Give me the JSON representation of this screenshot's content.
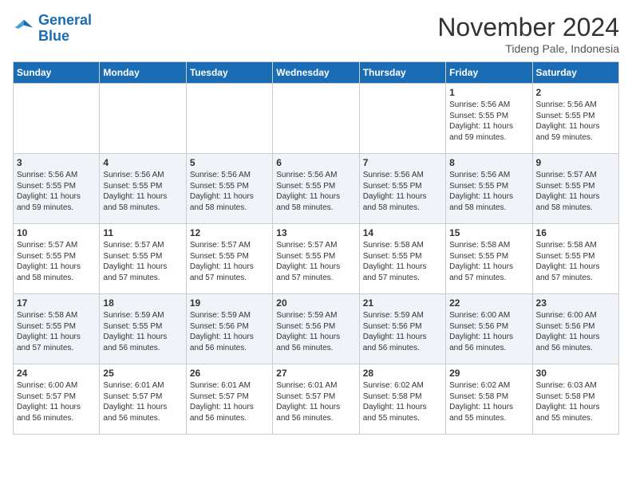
{
  "header": {
    "logo_line1": "General",
    "logo_line2": "Blue",
    "month": "November 2024",
    "location": "Tideng Pale, Indonesia"
  },
  "weekdays": [
    "Sunday",
    "Monday",
    "Tuesday",
    "Wednesday",
    "Thursday",
    "Friday",
    "Saturday"
  ],
  "weeks": [
    [
      {
        "day": "",
        "info": ""
      },
      {
        "day": "",
        "info": ""
      },
      {
        "day": "",
        "info": ""
      },
      {
        "day": "",
        "info": ""
      },
      {
        "day": "",
        "info": ""
      },
      {
        "day": "1",
        "info": "Sunrise: 5:56 AM\nSunset: 5:55 PM\nDaylight: 11 hours\nand 59 minutes."
      },
      {
        "day": "2",
        "info": "Sunrise: 5:56 AM\nSunset: 5:55 PM\nDaylight: 11 hours\nand 59 minutes."
      }
    ],
    [
      {
        "day": "3",
        "info": "Sunrise: 5:56 AM\nSunset: 5:55 PM\nDaylight: 11 hours\nand 59 minutes."
      },
      {
        "day": "4",
        "info": "Sunrise: 5:56 AM\nSunset: 5:55 PM\nDaylight: 11 hours\nand 58 minutes."
      },
      {
        "day": "5",
        "info": "Sunrise: 5:56 AM\nSunset: 5:55 PM\nDaylight: 11 hours\nand 58 minutes."
      },
      {
        "day": "6",
        "info": "Sunrise: 5:56 AM\nSunset: 5:55 PM\nDaylight: 11 hours\nand 58 minutes."
      },
      {
        "day": "7",
        "info": "Sunrise: 5:56 AM\nSunset: 5:55 PM\nDaylight: 11 hours\nand 58 minutes."
      },
      {
        "day": "8",
        "info": "Sunrise: 5:56 AM\nSunset: 5:55 PM\nDaylight: 11 hours\nand 58 minutes."
      },
      {
        "day": "9",
        "info": "Sunrise: 5:57 AM\nSunset: 5:55 PM\nDaylight: 11 hours\nand 58 minutes."
      }
    ],
    [
      {
        "day": "10",
        "info": "Sunrise: 5:57 AM\nSunset: 5:55 PM\nDaylight: 11 hours\nand 58 minutes."
      },
      {
        "day": "11",
        "info": "Sunrise: 5:57 AM\nSunset: 5:55 PM\nDaylight: 11 hours\nand 57 minutes."
      },
      {
        "day": "12",
        "info": "Sunrise: 5:57 AM\nSunset: 5:55 PM\nDaylight: 11 hours\nand 57 minutes."
      },
      {
        "day": "13",
        "info": "Sunrise: 5:57 AM\nSunset: 5:55 PM\nDaylight: 11 hours\nand 57 minutes."
      },
      {
        "day": "14",
        "info": "Sunrise: 5:58 AM\nSunset: 5:55 PM\nDaylight: 11 hours\nand 57 minutes."
      },
      {
        "day": "15",
        "info": "Sunrise: 5:58 AM\nSunset: 5:55 PM\nDaylight: 11 hours\nand 57 minutes."
      },
      {
        "day": "16",
        "info": "Sunrise: 5:58 AM\nSunset: 5:55 PM\nDaylight: 11 hours\nand 57 minutes."
      }
    ],
    [
      {
        "day": "17",
        "info": "Sunrise: 5:58 AM\nSunset: 5:55 PM\nDaylight: 11 hours\nand 57 minutes."
      },
      {
        "day": "18",
        "info": "Sunrise: 5:59 AM\nSunset: 5:55 PM\nDaylight: 11 hours\nand 56 minutes."
      },
      {
        "day": "19",
        "info": "Sunrise: 5:59 AM\nSunset: 5:56 PM\nDaylight: 11 hours\nand 56 minutes."
      },
      {
        "day": "20",
        "info": "Sunrise: 5:59 AM\nSunset: 5:56 PM\nDaylight: 11 hours\nand 56 minutes."
      },
      {
        "day": "21",
        "info": "Sunrise: 5:59 AM\nSunset: 5:56 PM\nDaylight: 11 hours\nand 56 minutes."
      },
      {
        "day": "22",
        "info": "Sunrise: 6:00 AM\nSunset: 5:56 PM\nDaylight: 11 hours\nand 56 minutes."
      },
      {
        "day": "23",
        "info": "Sunrise: 6:00 AM\nSunset: 5:56 PM\nDaylight: 11 hours\nand 56 minutes."
      }
    ],
    [
      {
        "day": "24",
        "info": "Sunrise: 6:00 AM\nSunset: 5:57 PM\nDaylight: 11 hours\nand 56 minutes."
      },
      {
        "day": "25",
        "info": "Sunrise: 6:01 AM\nSunset: 5:57 PM\nDaylight: 11 hours\nand 56 minutes."
      },
      {
        "day": "26",
        "info": "Sunrise: 6:01 AM\nSunset: 5:57 PM\nDaylight: 11 hours\nand 56 minutes."
      },
      {
        "day": "27",
        "info": "Sunrise: 6:01 AM\nSunset: 5:57 PM\nDaylight: 11 hours\nand 56 minutes."
      },
      {
        "day": "28",
        "info": "Sunrise: 6:02 AM\nSunset: 5:58 PM\nDaylight: 11 hours\nand 55 minutes."
      },
      {
        "day": "29",
        "info": "Sunrise: 6:02 AM\nSunset: 5:58 PM\nDaylight: 11 hours\nand 55 minutes."
      },
      {
        "day": "30",
        "info": "Sunrise: 6:03 AM\nSunset: 5:58 PM\nDaylight: 11 hours\nand 55 minutes."
      }
    ]
  ]
}
